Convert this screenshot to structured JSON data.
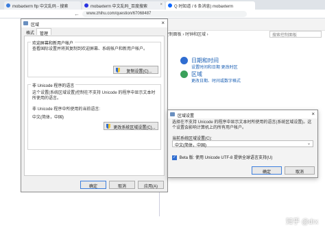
{
  "browser": {
    "tabs": [
      {
        "label": "mobaxterm ftp 中文乱码 - 搜索",
        "active": false
      },
      {
        "label": "mobaxterm 中文乱码_百度搜索",
        "active": false
      },
      {
        "label": "Q 时知道 / 6 条消息) mobaxterm",
        "active": true
      }
    ],
    "url": "www.zhihu.com/question/67068487"
  },
  "control_panel": {
    "breadcrumb": "› 控制面板 › 时钟和区域 ›",
    "search_placeholder": "搜索控制面板",
    "items": [
      {
        "title": "日期和时间",
        "links": "设置时间和日期   更改时区",
        "icon_color": "#2f6dd1"
      },
      {
        "title": "区域",
        "links": "更改日期、时间或数字格式",
        "icon_color": "#3aa05a"
      }
    ]
  },
  "region_dialog": {
    "title": "区域",
    "tabs": [
      "格式",
      "管理"
    ],
    "welcome_group": {
      "title": "欢迎屏幕和新用户帐户",
      "text": "查看国际设置并将其复制到欢迎屏幕、系统帐户和新用户帐户。",
      "button": "复制设置(C)..."
    },
    "unicode_group": {
      "title": "非 Unicode 程序的语言",
      "text": "这个设置(系统区域设置)控制在不支持 Unicode 的程序中显示文本时所使用的语言。",
      "current_label": "非 Unicode 程序中所使用的当前语言:",
      "current_value": "中文(简体，中国)",
      "button": "更改系统区域设置(C)..."
    },
    "buttons": {
      "ok": "确定",
      "cancel": "取消",
      "apply": "应用(A)"
    }
  },
  "region_settings": {
    "title": "区域设置",
    "description": "选择在不支持 Unicode 的程序中显示文本时所使用的语言(系统区域设置)。这个设置会影响计算机上的所有用户帐户。",
    "select_label": "当前系统区域设置(C):",
    "select_value": "中文(简体，中国)",
    "beta_checkbox": "Beta 版: 使用 Unicode UTF-8 提供全球语言支持(U)",
    "beta_checked": true,
    "buttons": {
      "ok": "确定",
      "cancel": "取消"
    }
  },
  "watermark": "知乎 @drx"
}
